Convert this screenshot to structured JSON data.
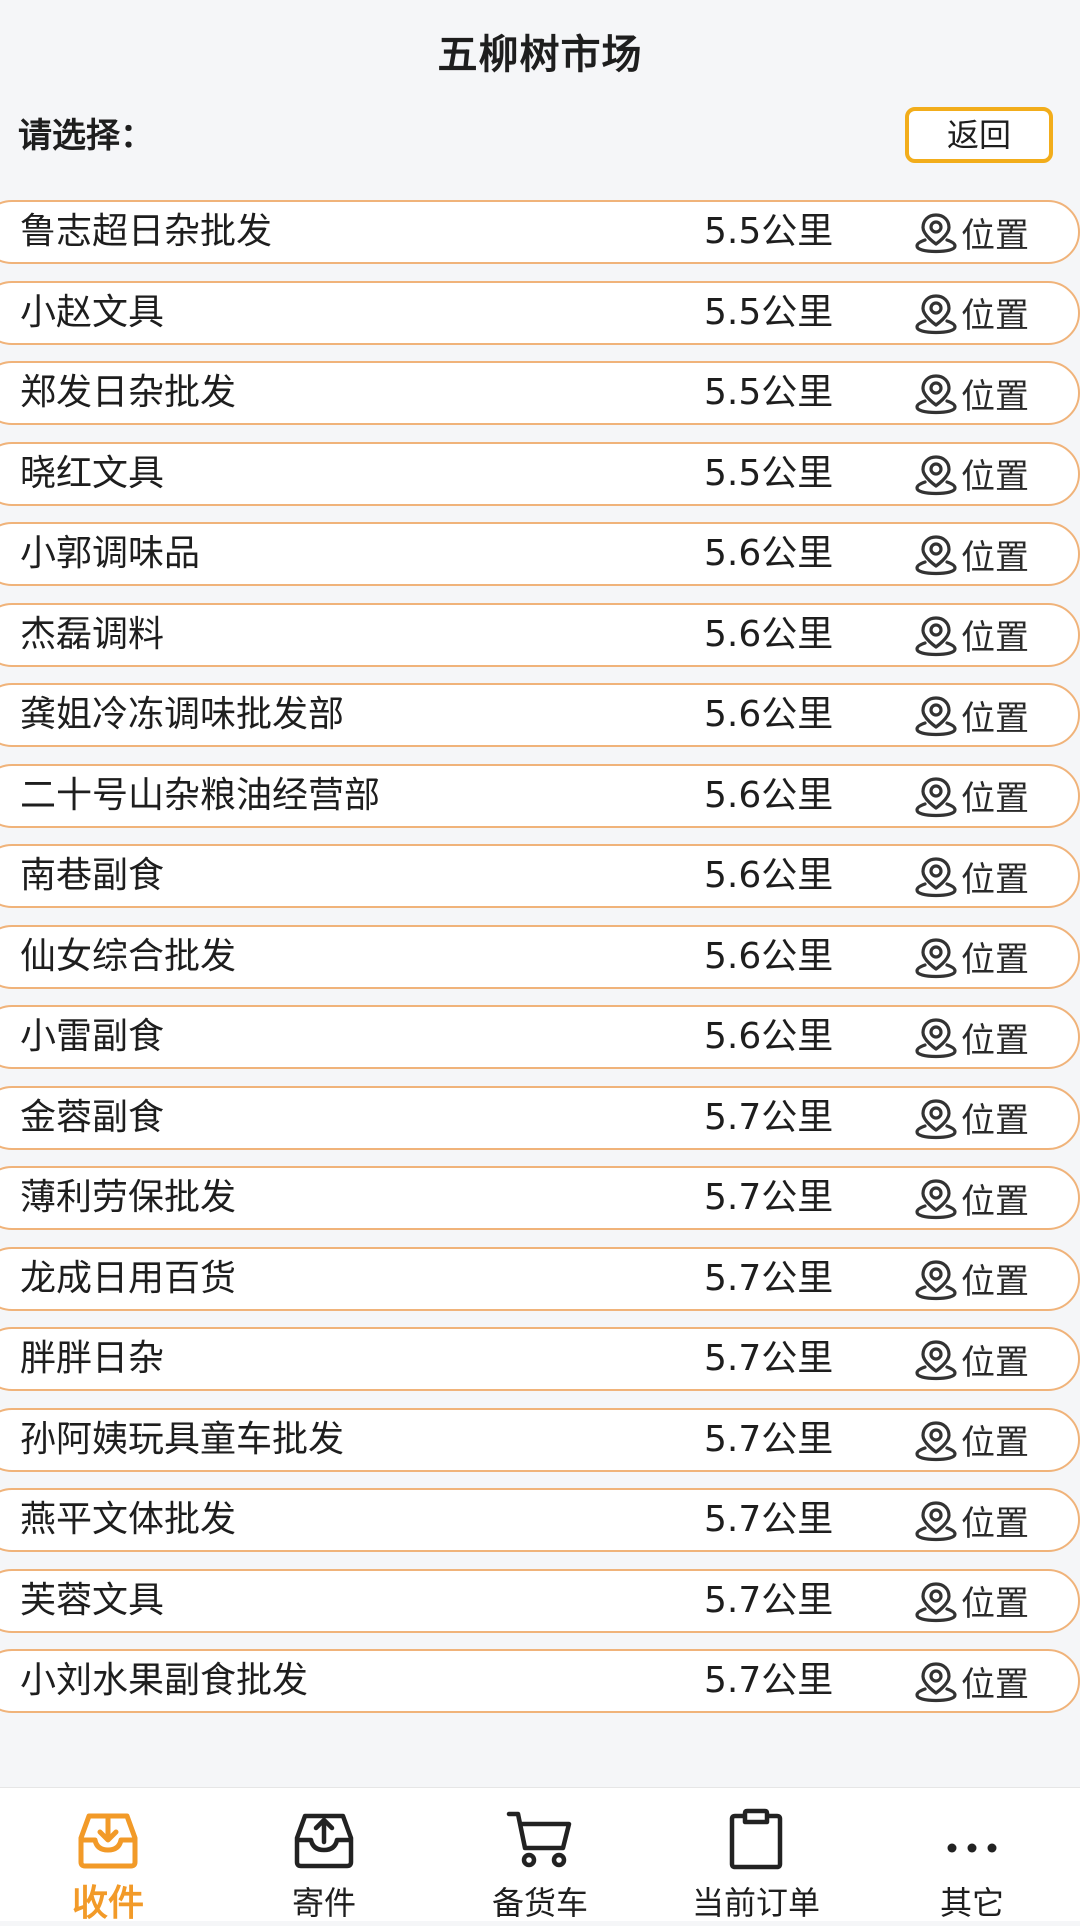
{
  "header": {
    "title": "五柳树市场",
    "prompt": "请选择：",
    "back_label": "返回"
  },
  "location_label": "位置",
  "shops": [
    {
      "name": "鲁志超日杂批发",
      "distance": "5.5公里"
    },
    {
      "name": "小赵文具",
      "distance": "5.5公里"
    },
    {
      "name": "郑发日杂批发",
      "distance": "5.5公里"
    },
    {
      "name": "晓红文具",
      "distance": "5.5公里"
    },
    {
      "name": "小郭调味品",
      "distance": "5.6公里"
    },
    {
      "name": "杰磊调料",
      "distance": "5.6公里"
    },
    {
      "name": "龚姐冷冻调味批发部",
      "distance": "5.6公里"
    },
    {
      "name": "二十号山杂粮油经营部",
      "distance": "5.6公里"
    },
    {
      "name": "南巷副食",
      "distance": "5.6公里"
    },
    {
      "name": "仙女综合批发",
      "distance": "5.6公里"
    },
    {
      "name": "小雷副食",
      "distance": "5.6公里"
    },
    {
      "name": "金蓉副食",
      "distance": "5.7公里"
    },
    {
      "name": "薄利劳保批发",
      "distance": "5.7公里"
    },
    {
      "name": "龙成日用百货",
      "distance": "5.7公里"
    },
    {
      "name": "胖胖日杂",
      "distance": "5.7公里"
    },
    {
      "name": "孙阿姨玩具童车批发",
      "distance": "5.7公里"
    },
    {
      "name": "燕平文体批发",
      "distance": "5.7公里"
    },
    {
      "name": "芙蓉文具",
      "distance": "5.7公里"
    },
    {
      "name": "小刘水果副食批发",
      "distance": "5.7公里"
    }
  ],
  "nav": {
    "items": [
      {
        "label": "收件",
        "icon": "inbox-download-icon",
        "active": true
      },
      {
        "label": "寄件",
        "icon": "outbox-upload-icon",
        "active": false
      },
      {
        "label": "备货车",
        "icon": "cart-icon",
        "active": false
      },
      {
        "label": "当前订单",
        "icon": "clipboard-icon",
        "active": false
      },
      {
        "label": "其它",
        "icon": "more-dots-icon",
        "active": false
      }
    ]
  },
  "colors": {
    "accent": "#f29a28",
    "back_border": "#f2ad1b",
    "row_border": "#f0b37a",
    "background": "#f5f6f8"
  }
}
